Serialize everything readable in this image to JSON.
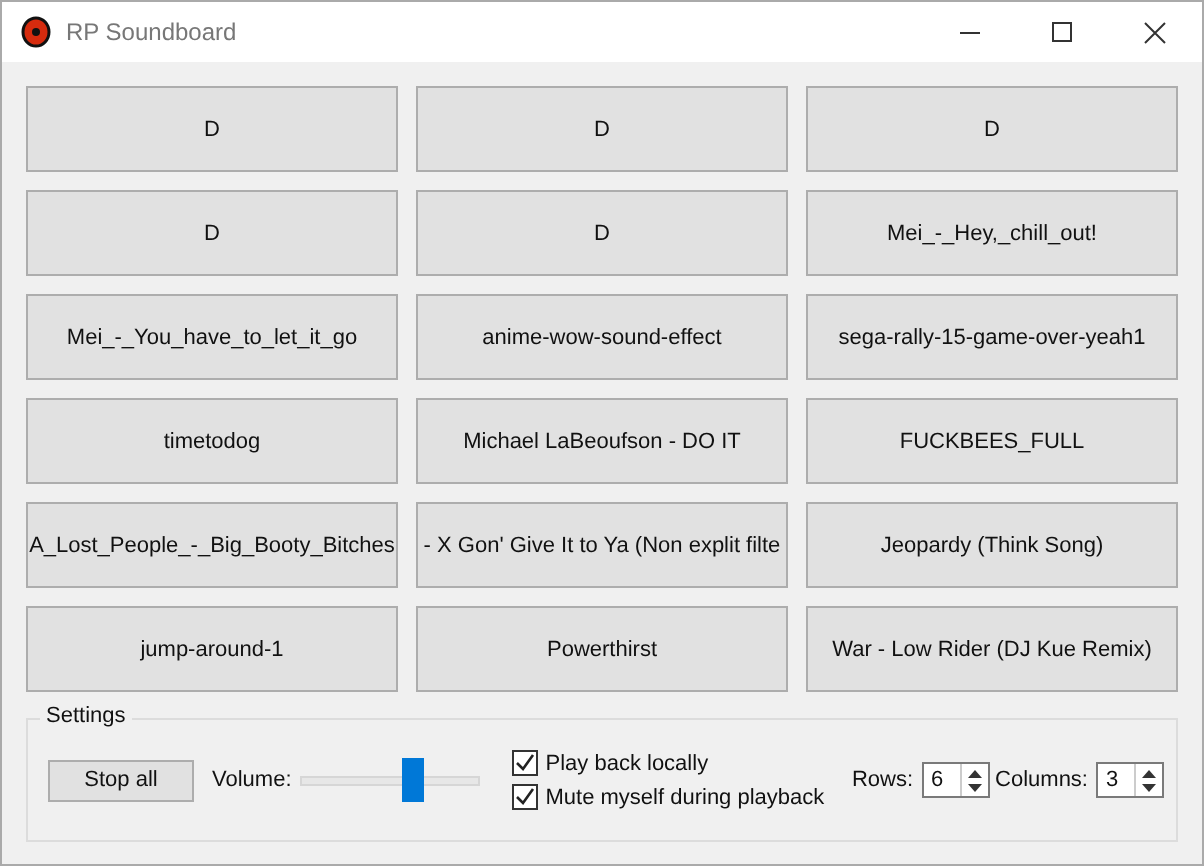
{
  "window": {
    "title": "RP Soundboard"
  },
  "sounds": [
    {
      "label": "D"
    },
    {
      "label": "D"
    },
    {
      "label": "D"
    },
    {
      "label": "D"
    },
    {
      "label": "D"
    },
    {
      "label": "Mei_-_Hey,_chill_out!"
    },
    {
      "label": "Mei_-_You_have_to_let_it_go"
    },
    {
      "label": "anime-wow-sound-effect"
    },
    {
      "label": "sega-rally-15-game-over-yeah1"
    },
    {
      "label": "timetodog"
    },
    {
      "label": "Michael LaBeoufson - DO IT"
    },
    {
      "label": "FUCKBEES_FULL"
    },
    {
      "label": "A_Lost_People_-_Big_Booty_Bitches"
    },
    {
      "label": "- X Gon' Give It to Ya (Non explit filte"
    },
    {
      "label": "Jeopardy (Think Song)"
    },
    {
      "label": "jump-around-1"
    },
    {
      "label": "Powerthirst"
    },
    {
      "label": "War - Low Rider (DJ Kue Remix)"
    }
  ],
  "settings": {
    "title": "Settings",
    "stop_button": "Stop all",
    "volume": {
      "label": "Volume:",
      "level": 0.65
    },
    "checkboxes": [
      {
        "label": "Play back locally",
        "checked": true
      },
      {
        "label": "Mute myself during playback",
        "checked": true
      }
    ],
    "rows": {
      "label": "Rows:",
      "value": "6"
    },
    "columns": {
      "label": "Columns:",
      "value": "3"
    }
  }
}
